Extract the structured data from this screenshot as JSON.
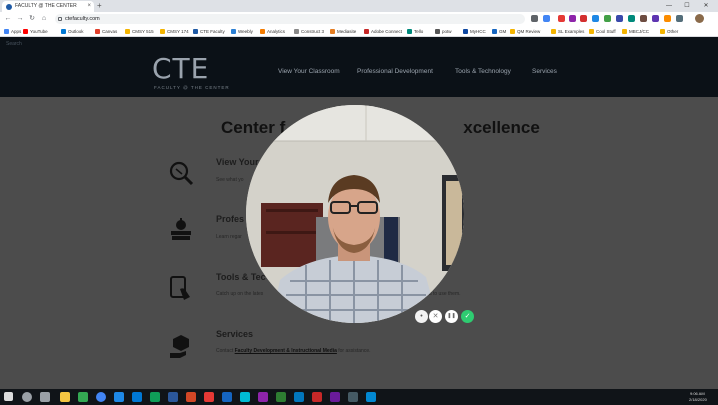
{
  "browser": {
    "tab_title": "FACULTY @ THE CENTER",
    "tab_close": "×",
    "new_tab": "+",
    "window_controls": [
      "—",
      "☐",
      "✕"
    ],
    "nav_buttons": [
      "←",
      "→",
      "↻",
      "⌂"
    ],
    "url": "ctefaculty.com",
    "bookmarks": [
      {
        "label": "Apps",
        "color": "#4285f4"
      },
      {
        "label": "YouTube",
        "color": "#ff0000"
      },
      {
        "label": "Outlook",
        "color": "#0078d4"
      },
      {
        "label": "Canvas",
        "color": "#e13f2b"
      },
      {
        "label": "CMSY 515",
        "color": "#f4b400"
      },
      {
        "label": "CMSY 174",
        "color": "#f4b400"
      },
      {
        "label": "CTE Faculty",
        "color": "#1f5aa5"
      },
      {
        "label": "Weebly",
        "color": "#2a7fd4"
      },
      {
        "label": "Analytics",
        "color": "#f57c00"
      },
      {
        "label": "Construct 3",
        "color": "#888888"
      },
      {
        "label": "Mediasite",
        "color": "#e67e22"
      },
      {
        "label": "Adobe Connect",
        "color": "#c62828"
      },
      {
        "label": "Tello",
        "color": "#00897b"
      },
      {
        "label": "potw",
        "color": "#555555"
      },
      {
        "label": "MyHCC",
        "color": "#0d47a1"
      },
      {
        "label": "GM",
        "color": "#1565c0"
      },
      {
        "label": "QM Review",
        "color": "#f4b400"
      },
      {
        "label": "SL Examples",
        "color": "#f4b400"
      },
      {
        "label": "Cool Stuff",
        "color": "#f4b400"
      },
      {
        "label": "MBCJ/CC",
        "color": "#f4b400"
      },
      {
        "label": "Other",
        "color": "#f4b400"
      }
    ]
  },
  "site": {
    "search_label": "Search",
    "logo_text": "CTE",
    "logo_subtitle": "FACULTY @ THE CENTER",
    "nav": [
      "View Your Classroom",
      "Professional Development",
      "Tools & Technology",
      "Services"
    ],
    "headline": "Center f",
    "headline_tail": "xcellence",
    "services": [
      {
        "title": "View Your",
        "desc": "See what yo",
        "icon": "magnifier-icon"
      },
      {
        "title": "Profes",
        "desc": "Learn regar",
        "icon": "apple-books-icon"
      },
      {
        "title": "Tools & Tec",
        "desc": "Catch up on the lates",
        "desc_tail": "eed to use them.",
        "icon": "touch-device-icon"
      },
      {
        "title": "Services",
        "desc": "Contact",
        "link": "Faculty Development & Instructional Media",
        "desc_tail": "for assistance.",
        "icon": "box-hand-icon"
      }
    ]
  },
  "camera": {
    "controls": [
      {
        "name": "camera-menu-button",
        "glyph": "•",
        "color": "#f2f2f2"
      },
      {
        "name": "camera-cancel-button",
        "glyph": "✕",
        "color": "#ffffff"
      },
      {
        "name": "camera-pause-button",
        "glyph": "❚❚",
        "color": "#ffffff"
      },
      {
        "name": "camera-confirm-button",
        "glyph": "✓",
        "color": "#2ecc71"
      }
    ]
  },
  "taskbar": {
    "time": "9:06 AM",
    "date": "2/18/2020"
  }
}
